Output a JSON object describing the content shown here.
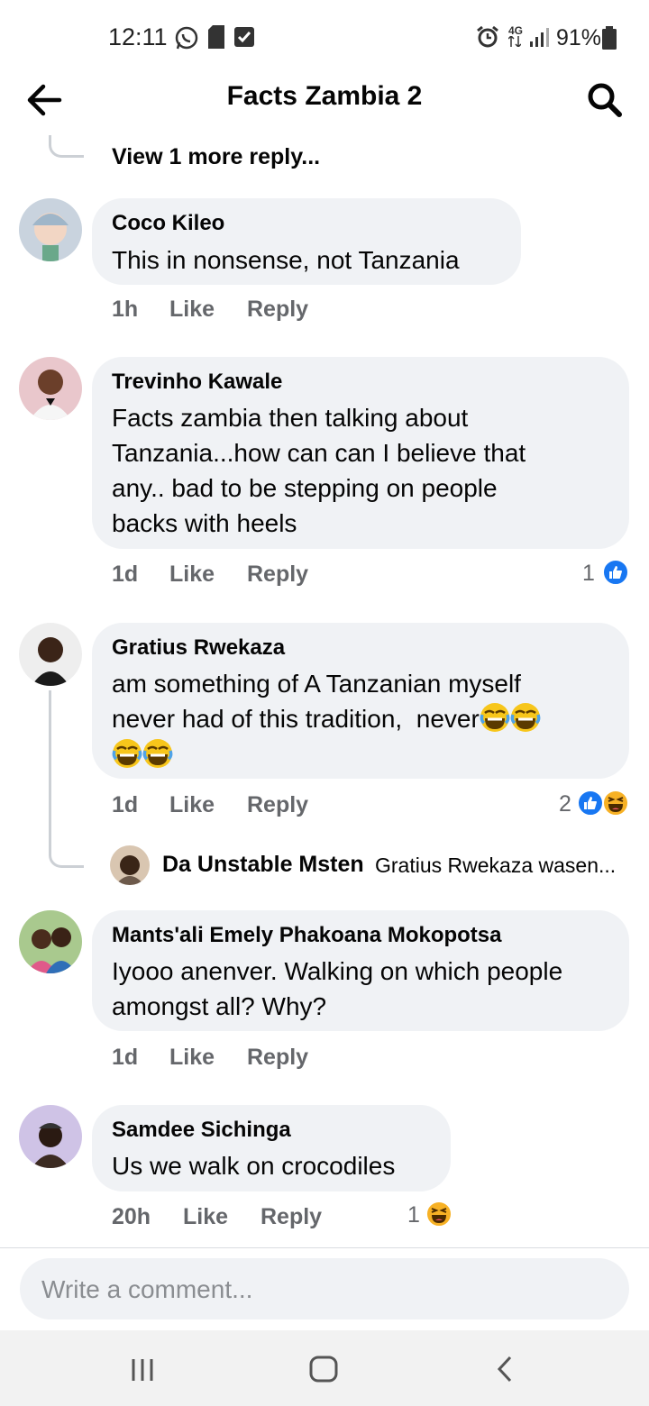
{
  "status_bar": {
    "time": "12:11",
    "network": "4G",
    "battery_percent": "91%",
    "icons": [
      "whatsapp-icon",
      "sd-card-icon",
      "checkbox-notification-icon",
      "alarm-icon",
      "network-4g-icon",
      "signal-icon",
      "battery-icon"
    ]
  },
  "header": {
    "title": "Facts Zambia 2",
    "back_icon": "arrow-left-icon",
    "search_icon": "search-icon"
  },
  "thread": {
    "view_more": "View 1 more reply..."
  },
  "comments": [
    {
      "author": "Coco Kileo",
      "lines": [
        "This in nonsense, not Tanzania"
      ],
      "time": "1h",
      "like": "Like",
      "reply": "Reply",
      "reaction_count": "",
      "reactions": []
    },
    {
      "author": "Trevinho Kawale",
      "lines": [
        "Facts zambia then talking about",
        "Tanzania...how can can I believe that",
        "any.. bad to be stepping on people",
        "backs with heels"
      ],
      "time": "1d",
      "like": "Like",
      "reply": "Reply",
      "reaction_count": "1",
      "reactions": [
        "like-reaction-icon"
      ]
    },
    {
      "author": "Gratius Rwekaza",
      "lines": [
        "am something of A Tanzanian myself",
        "never had of this tradition,  never"
      ],
      "emoji": "laugh-cry-emoji",
      "time": "1d",
      "like": "Like",
      "reply": "Reply",
      "reaction_count": "2",
      "reactions": [
        "like-reaction-icon",
        "haha-reaction-icon"
      ],
      "nested_reply": {
        "author": "Da Unstable Msten",
        "preview": "Gratius Rwekaza wasen..."
      }
    },
    {
      "author": "Mants'ali Emely Phakoana Mokopotsa",
      "lines": [
        "Iyooo anenver. Walking on which people",
        "amongst all? Why?"
      ],
      "time": "1d",
      "like": "Like",
      "reply": "Reply",
      "reaction_count": "",
      "reactions": []
    },
    {
      "author": "Samdee Sichinga",
      "lines": [
        "Us we walk on crocodiles"
      ],
      "time": "20h",
      "like": "Like",
      "reply": "Reply",
      "reaction_count": "1",
      "reactions": [
        "haha-reaction-icon"
      ]
    }
  ],
  "composer": {
    "placeholder": "Write a comment..."
  },
  "nav_bar": {
    "icons": [
      "recent-apps-icon",
      "home-icon",
      "back-icon"
    ]
  },
  "colors": {
    "bubble": "#f0f2f5",
    "meta_text": "#65676b",
    "like_blue": "#1877f2",
    "haha_yellow": "#f7b125"
  }
}
